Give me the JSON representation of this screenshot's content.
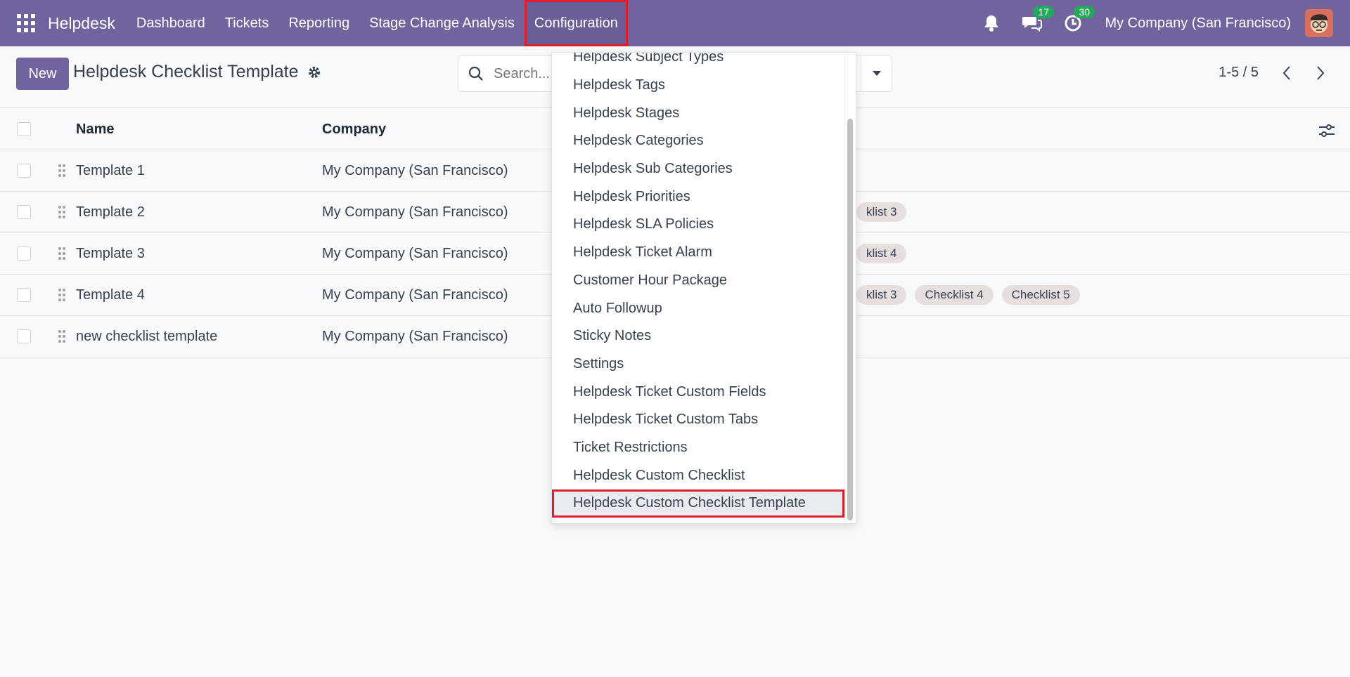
{
  "navbar": {
    "brand": "Helpdesk",
    "menu": [
      "Dashboard",
      "Tickets",
      "Reporting",
      "Stage Change Analysis",
      "Configuration"
    ],
    "messages_count": "17",
    "activities_count": "30",
    "company": "My Company (San Francisco)"
  },
  "control": {
    "new_label": "New",
    "title": "Helpdesk Checklist Template",
    "search_placeholder": "Search...",
    "pager": "1-5 / 5"
  },
  "table": {
    "headers": {
      "name": "Name",
      "company": "Company"
    },
    "rows": [
      {
        "name": "Template 1",
        "company": "My Company (San Francisco)",
        "tags": []
      },
      {
        "name": "Template 2",
        "company": "My Company (San Francisco)",
        "tags": [
          "klist 3"
        ]
      },
      {
        "name": "Template 3",
        "company": "My Company (San Francisco)",
        "tags": [
          "klist 4"
        ]
      },
      {
        "name": "Template 4",
        "company": "My Company (San Francisco)",
        "tags": [
          "klist 3",
          "Checklist 4",
          "Checklist 5"
        ]
      },
      {
        "name": "new checklist template",
        "company": "My Company (San Francisco)",
        "tags": []
      }
    ]
  },
  "dropdown": {
    "items": [
      "Helpdesk Subject Types",
      "Helpdesk Tags",
      "Helpdesk Stages",
      "Helpdesk Categories",
      "Helpdesk Sub Categories",
      "Helpdesk Priorities",
      "Helpdesk SLA Policies",
      "Helpdesk Ticket Alarm",
      "Customer Hour Package",
      "Auto Followup",
      "Sticky Notes",
      "Settings",
      "Helpdesk Ticket Custom Fields",
      "Helpdesk Ticket Custom Tabs",
      "Ticket Restrictions",
      "Helpdesk Custom Checklist",
      "Helpdesk Custom Checklist Template"
    ],
    "highlighted_index": 16
  },
  "colors": {
    "brand": "#71639e",
    "badge": "#22a95c",
    "highlight_border": "#e01e2b",
    "tag_bg": "#e7dede"
  }
}
